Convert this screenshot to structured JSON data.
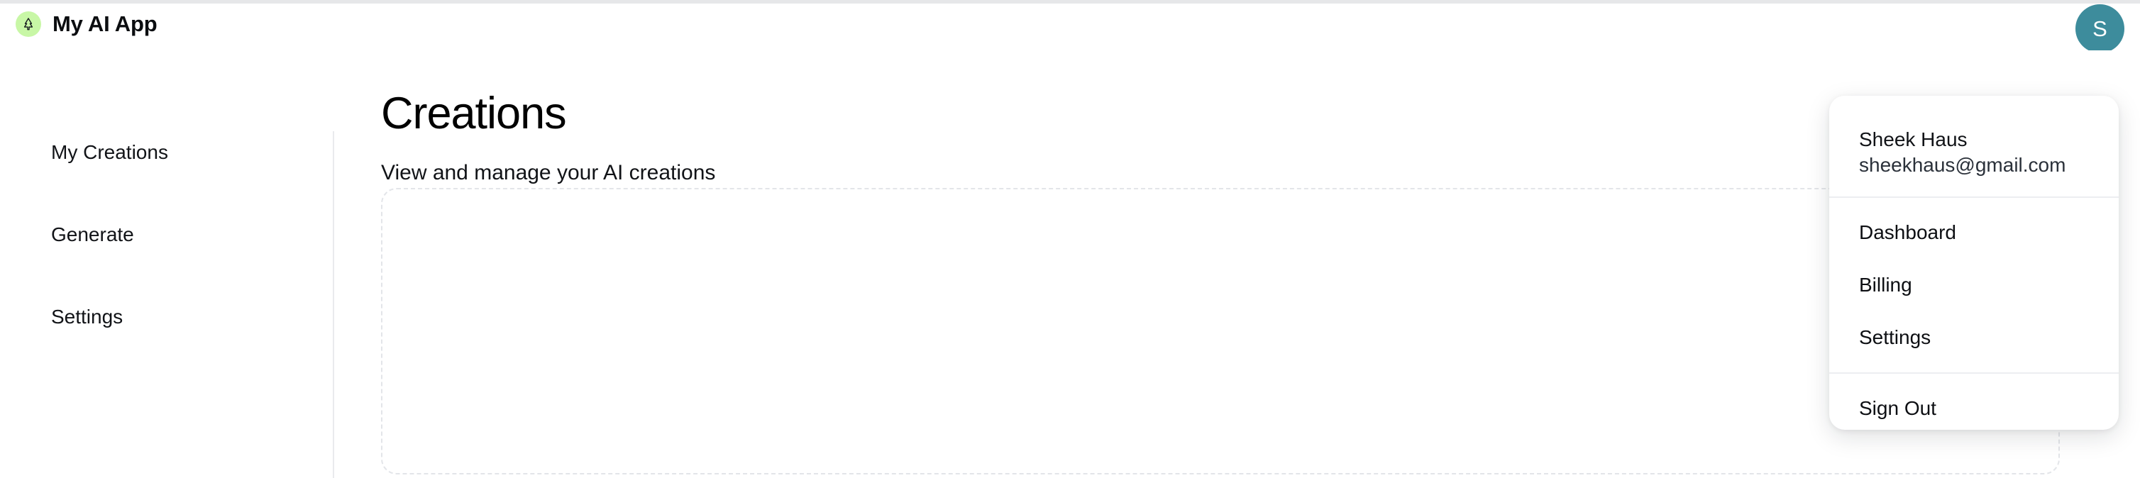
{
  "header": {
    "logo_icon": "pine-tree-icon",
    "logo_badge_color": "#c8f7a6",
    "app_title": "My AI App",
    "avatar": {
      "initial": "S",
      "background_color": "#3d8c9c",
      "text_color": "#ffffff"
    }
  },
  "sidebar": {
    "items": [
      {
        "label": "My Creations"
      },
      {
        "label": "Generate"
      },
      {
        "label": "Settings"
      }
    ]
  },
  "main": {
    "title": "Creations",
    "subtitle": "View and manage your AI creations",
    "empty_state": {
      "border_style": "dashed",
      "border_color": "#e3e5e9",
      "content": ""
    }
  },
  "account_menu": {
    "name": "Sheek Haus",
    "email": "sheekhaus@gmail.com",
    "primary_items": [
      {
        "label": "Dashboard"
      },
      {
        "label": "Billing"
      },
      {
        "label": "Settings"
      }
    ],
    "secondary_items": [
      {
        "label": "Sign Out"
      }
    ]
  }
}
